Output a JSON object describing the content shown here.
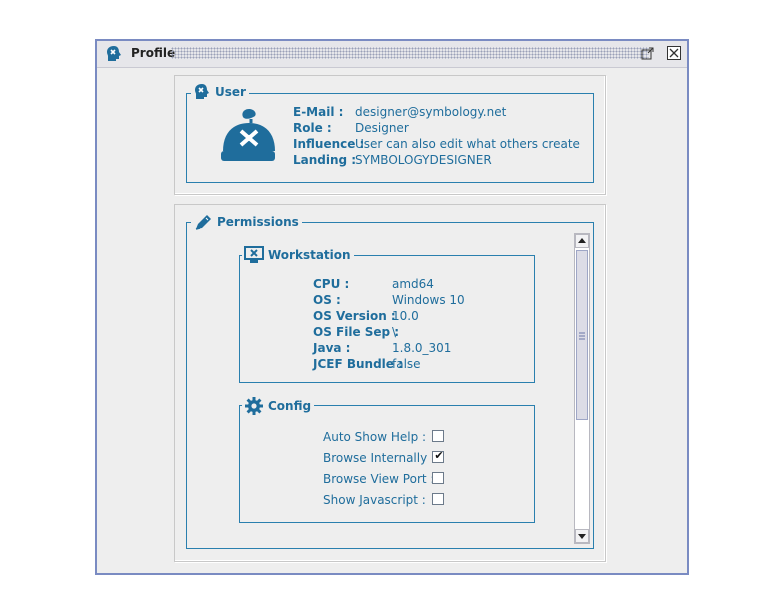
{
  "window": {
    "title": "Profile",
    "icons": [
      "profile-head-icon",
      "restore-icon",
      "close-icon"
    ]
  },
  "user": {
    "legend": "User",
    "email_label": "E-Mail :",
    "email_value": "designer@symbology.net",
    "role_label": "Role :",
    "role_value": "Designer",
    "influence_label": "Influence :",
    "influence_value": "User can also edit what others create",
    "landing_label": "Landing :",
    "landing_value": "SYMBOLOGYDESIGNER"
  },
  "permissions": {
    "legend": "Permissions",
    "workstation": {
      "legend": "Workstation",
      "rows": [
        {
          "label": "CPU :",
          "value": "amd64"
        },
        {
          "label": "OS :",
          "value": "Windows 10"
        },
        {
          "label": "OS Version :",
          "value": "10.0"
        },
        {
          "label": "OS File Sep :",
          "value": "\\"
        },
        {
          "label": "Java :",
          "value": "1.8.0_301"
        },
        {
          "label": "JCEF Bundle :",
          "value": "false"
        }
      ]
    },
    "config": {
      "legend": "Config",
      "items": [
        {
          "label": "Auto Show Help :",
          "checked": false,
          "mark": ""
        },
        {
          "label": "Browse Internally :",
          "checked": true,
          "mark": "✔"
        },
        {
          "label": "Browse View Port :",
          "checked": false,
          "mark": ""
        },
        {
          "label": "Show Javascript :",
          "checked": false,
          "mark": ""
        }
      ]
    }
  },
  "colors": {
    "accent": "#1f6d9c",
    "border": "#2a7fae",
    "window_frame": "#7a8bc2",
    "background": "#eeeeee"
  }
}
